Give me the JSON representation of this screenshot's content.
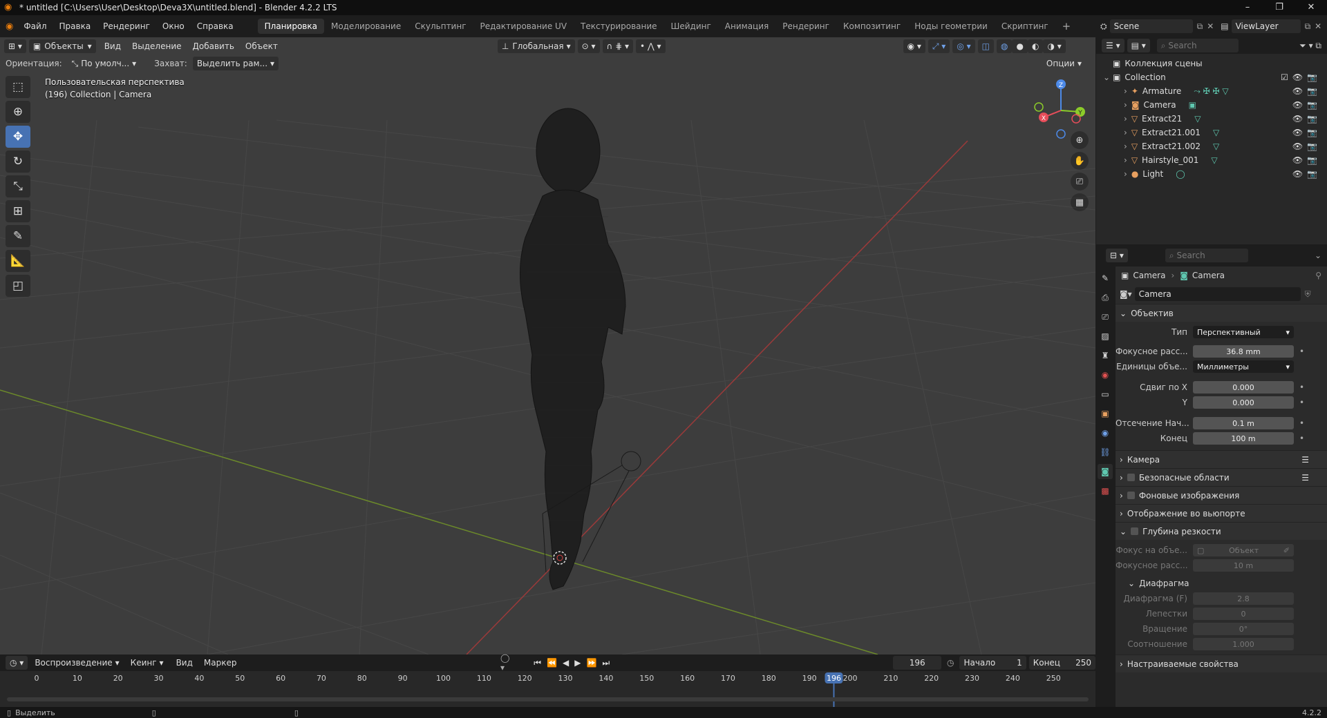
{
  "title": "* untitled [C:\\Users\\User\\Desktop\\Deva3X\\untitled.blend] - Blender 4.2.2 LTS",
  "window_buttons": [
    "–",
    "❐",
    "✕"
  ],
  "menu": [
    "Файл",
    "Правка",
    "Рендеринг",
    "Окно",
    "Справка"
  ],
  "workspaces": [
    "Планировка",
    "Моделирование",
    "Скульптинг",
    "Редактирование UV",
    "Текстурирование",
    "Шейдинг",
    "Анимация",
    "Рендеринг",
    "Композитинг",
    "Ноды геометрии",
    "Скриптинг"
  ],
  "active_workspace_index": 0,
  "scene": {
    "label": "Scene",
    "viewlayer": "ViewLayer"
  },
  "viewport": {
    "mode": "Объекты",
    "header_menu": [
      "Вид",
      "Выделение",
      "Добавить",
      "Объект"
    ],
    "transform_orientation": "Глобальная",
    "orientation_label": "Ориентация:",
    "orientation_value": "По умолч...",
    "snap_label": "Захват:",
    "snap_value": "Выделить рам...",
    "options": "Опции",
    "info_line1": "Пользовательская перспектива",
    "info_line2": "(196) Collection | Camera",
    "gizmo": {
      "x": "X",
      "y": "Y",
      "z": "Z"
    }
  },
  "tools": [
    "select-box",
    "cursor",
    "move",
    "rotate",
    "scale",
    "transform",
    "annotate",
    "measure",
    "add-cube"
  ],
  "outliner": {
    "search_placeholder": "Search",
    "scene_collection": "Коллекция сцены",
    "collection": "Collection",
    "items": [
      {
        "name": "Armature",
        "color": "#e8a060"
      },
      {
        "name": "Camera",
        "color": "#e8a060"
      },
      {
        "name": "Extract21",
        "color": "#e8a060"
      },
      {
        "name": "Extract21.001",
        "color": "#e8a060"
      },
      {
        "name": "Extract21.002",
        "color": "#e8a060"
      },
      {
        "name": "Hairstyle_001",
        "color": "#e8a060"
      },
      {
        "name": "Light",
        "color": "#e8a060"
      }
    ]
  },
  "properties": {
    "search_placeholder": "Search",
    "breadcrumb_obj": "Camera",
    "breadcrumb_data": "Camera",
    "datablock": "Camera",
    "panel_lens": "Объектив",
    "type_label": "Тип",
    "type_value": "Перспективный",
    "focal_label": "Фокусное расс...",
    "focal_value": "36.8 mm",
    "units_label": "Единицы объе...",
    "units_value": "Миллиметры",
    "shiftx_label": "Сдвиг по X",
    "shiftx_value": "0.000",
    "shifty_label": "Y",
    "shifty_value": "0.000",
    "clipstart_label": "Отсечение Нач...",
    "clipstart_value": "0.1 m",
    "clipend_label": "Конец",
    "clipend_value": "100 m",
    "panel_camera": "Камера",
    "panel_safe": "Безопасные области",
    "panel_bg": "Фоновые изображения",
    "panel_viewport": "Отображение во вьюпорте",
    "panel_dof": "Глубина резкости",
    "dof_focus_obj_label": "Фокус на объе...",
    "dof_focus_obj_value": "Объект",
    "dof_focus_dist_label": "Фокусное расс...",
    "dof_focus_dist_value": "10 m",
    "panel_aperture": "Диафрагма",
    "fstop_label": "Диафрагма (F)",
    "fstop_value": "2.8",
    "blades_label": "Лепестки",
    "blades_value": "0",
    "rotation_label": "Вращение",
    "rotation_value": "0°",
    "ratio_label": "Соотношение",
    "ratio_value": "1.000",
    "panel_custom": "Настраиваемые свойства"
  },
  "timeline": {
    "playback": "Воспроизведение",
    "keying": "Кеинг",
    "view": "Вид",
    "marker": "Маркер",
    "current_frame": "196",
    "start_label": "Начало",
    "start_value": "1",
    "end_label": "Конец",
    "end_value": "250",
    "ticks": [
      "0",
      "10",
      "20",
      "30",
      "40",
      "50",
      "60",
      "70",
      "80",
      "90",
      "100",
      "110",
      "120",
      "130",
      "140",
      "150",
      "160",
      "170",
      "180",
      "190",
      "196",
      "200",
      "210",
      "220",
      "230",
      "240",
      "250"
    ]
  },
  "status": {
    "select": "Выделить",
    "version": "4.2.2"
  }
}
